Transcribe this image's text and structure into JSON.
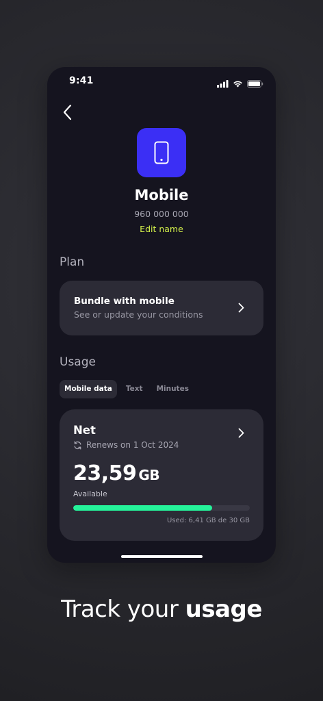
{
  "status_bar": {
    "time": "9:41",
    "icons": [
      "signal-icon",
      "wifi-icon",
      "battery-icon"
    ]
  },
  "header": {
    "back_icon": "chevron-left-icon",
    "device_icon": "smartphone-icon",
    "title": "Mobile",
    "number": "960 000 000",
    "edit_label": "Edit name"
  },
  "plan": {
    "section_title": "Plan",
    "card_title": "Bundle with mobile",
    "card_subtitle": "See or update your conditions"
  },
  "usage": {
    "section_title": "Usage",
    "tabs": [
      {
        "label": "Mobile data",
        "active": true
      },
      {
        "label": "Text",
        "active": false
      },
      {
        "label": "Minutes",
        "active": false
      }
    ],
    "card": {
      "title": "Net",
      "renews": "Renews on 1 Oct 2024",
      "value": "23,59",
      "unit": "GB",
      "available_label": "Available",
      "used_label": "Used: 6,41 GB de 30 GB",
      "progress_fraction": 0.7863
    }
  },
  "tagline": {
    "regular": "Track your ",
    "bold": "usage"
  },
  "colors": {
    "accent_blue": "#3b2ff5",
    "accent_lime": "#d3f04a",
    "progress_green": "#25f29a",
    "card_bg": "#2c2b36",
    "screen_bg": "#15141f"
  }
}
